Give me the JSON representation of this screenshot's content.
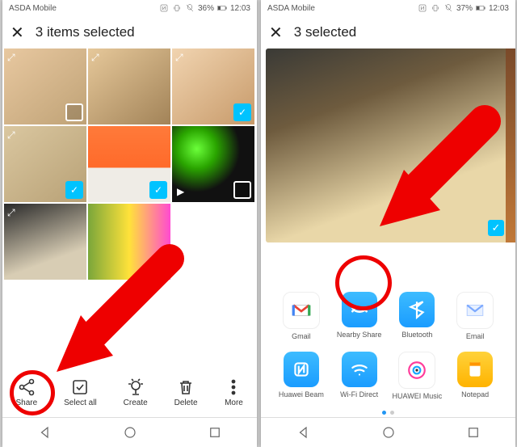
{
  "left": {
    "status": {
      "carrier": "ASDA Mobile",
      "battery": "36%",
      "time": "12:03"
    },
    "header": {
      "title": "3 items selected"
    },
    "cells": [
      {
        "selected": false,
        "expand": true,
        "play": false
      },
      {
        "selected": false,
        "expand": true,
        "play": false
      },
      {
        "selected": true,
        "expand": true,
        "play": false
      },
      {
        "selected": true,
        "expand": true,
        "play": false
      },
      {
        "selected": true,
        "expand": false,
        "play": false
      },
      {
        "selected": false,
        "expand": false,
        "play": true
      },
      {
        "selected": false,
        "expand": true,
        "play": false
      },
      {
        "selected": false,
        "expand": false,
        "play": false
      }
    ],
    "bottom": {
      "share": "Share",
      "select_all": "Select all",
      "create": "Create",
      "delete": "Delete",
      "more": "More"
    }
  },
  "right": {
    "status": {
      "carrier": "ASDA Mobile",
      "battery": "37%",
      "time": "12:03"
    },
    "header": {
      "title": "3 selected"
    },
    "share_targets": [
      {
        "label": "Gmail",
        "key": "gmail"
      },
      {
        "label": "Nearby Share",
        "key": "nearby"
      },
      {
        "label": "Bluetooth",
        "key": "bluetooth"
      },
      {
        "label": "Email",
        "key": "email"
      },
      {
        "label": "Huawei Beam",
        "key": "beam"
      },
      {
        "label": "Wi-Fi Direct",
        "key": "wifi"
      },
      {
        "label": "HUAWEI Music",
        "key": "music"
      },
      {
        "label": "Notepad",
        "key": "notepad"
      }
    ]
  },
  "annotation": {
    "highlight_left": "Share",
    "highlight_right": "Nearby Share"
  }
}
